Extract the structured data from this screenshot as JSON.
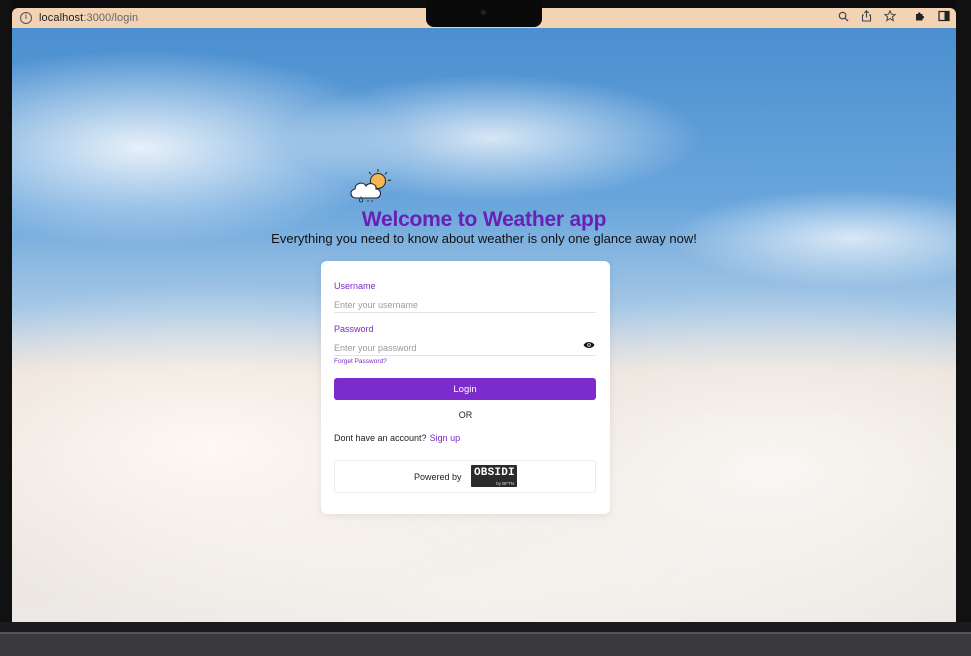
{
  "browser": {
    "url_host": "localhost",
    "url_path": ":3000/login",
    "icons": [
      "info-icon",
      "zoom-icon",
      "share-icon",
      "bookmark-star-icon",
      "extensions-icon",
      "sidebar-icon"
    ]
  },
  "header": {
    "title": "Welcome to Weather app",
    "subtitle": "Everything you need to know about weather is only one glance away now!",
    "logo_icon": "weather-cloud-sun-icon"
  },
  "form": {
    "username_label": "Username",
    "username_placeholder": "Enter your username",
    "password_label": "Password",
    "password_placeholder": "Enter your password",
    "forgot_label": "Forget Password?",
    "login_label": "Login",
    "or_label": "OR",
    "no_account_text": "Dont have an account?",
    "signup_label": "Sign up"
  },
  "footer": {
    "powered_label": "Powered by",
    "brand_name": "OBSIDI",
    "brand_sub": "by BFTN"
  },
  "colors": {
    "accent": "#7c2bcc",
    "title": "#6a1fb6",
    "chrome": "#f2d3b4"
  }
}
